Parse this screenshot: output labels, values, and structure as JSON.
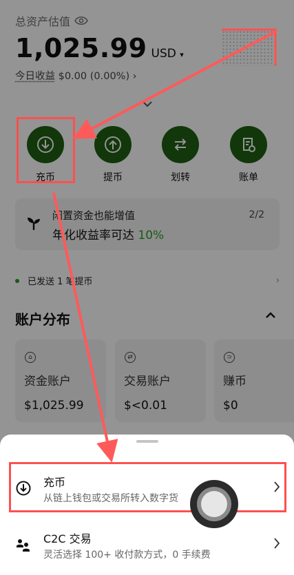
{
  "header": {
    "total_label": "总资产估值",
    "balance": "1,025.99",
    "currency": "USD",
    "currency_caret": "▾",
    "today_label": "今日收益",
    "today_value": "$0.00 (0.00%)",
    "today_arrow": "›"
  },
  "actions": [
    {
      "label": "充币",
      "icon": "deposit-icon"
    },
    {
      "label": "提币",
      "icon": "withdraw-icon"
    },
    {
      "label": "划转",
      "icon": "transfer-icon"
    },
    {
      "label": "账单",
      "icon": "bill-icon"
    }
  ],
  "promo": {
    "title": "闲置资金也能增值",
    "text": "年化收益率可达 ",
    "highlight": "10%",
    "page": "2/2",
    "icon": "sprout-icon"
  },
  "notice": {
    "text": "已发送 1 笔提币",
    "arrow": "›"
  },
  "distribution": {
    "title": "账户分布",
    "accounts": [
      {
        "name": "资金账户",
        "value": "$1,025.99",
        "icon": "wallet-icon",
        "glyph": "⌂"
      },
      {
        "name": "交易账户",
        "value": "$<0.01",
        "icon": "swap-icon",
        "glyph": "⇄"
      },
      {
        "name": "赚币",
        "value": "$0",
        "icon": "earn-icon",
        "glyph": "⊃"
      }
    ]
  },
  "sheet": {
    "options": [
      {
        "title": "充币",
        "subtitle": "从链上钱包或交易所转入数字货",
        "icon": "deposit-icon"
      },
      {
        "title": "C2C 交易",
        "subtitle": "灵活选择 100+ 收付款方式，0 手续费",
        "icon": "c2c-users-icon"
      }
    ]
  },
  "colors": {
    "accent_green": "#1e5f12",
    "highlight": "#2a9d2a",
    "annotation_red": "#ff4f4f"
  }
}
